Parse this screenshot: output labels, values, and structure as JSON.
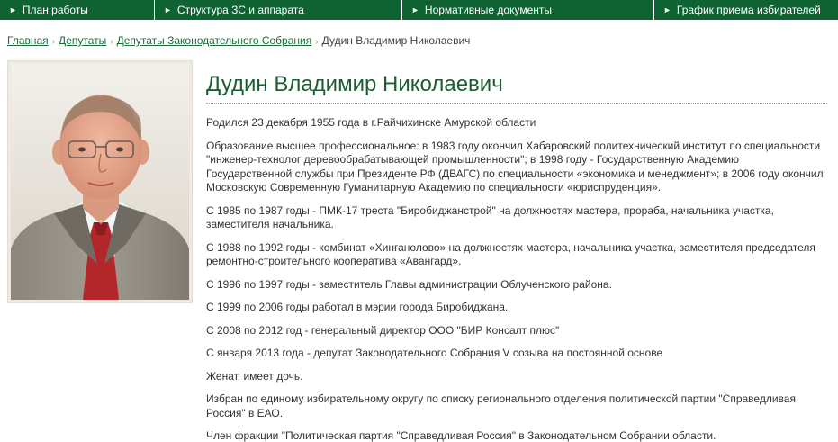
{
  "nav": {
    "items": [
      {
        "label": "План работы"
      },
      {
        "label": "Структура ЗС и аппарата"
      },
      {
        "label": "Нормативные документы"
      },
      {
        "label": "График приема избирателей"
      }
    ],
    "bg_color": "#0f6332",
    "arrow_glyph": "►"
  },
  "breadcrumb": {
    "items": [
      "Главная",
      "Депутаты",
      "Депутаты Законодательного Собрания"
    ],
    "current": "Дудин Владимир Николаевич",
    "separator": "›"
  },
  "profile": {
    "name": "Дудин Владимир Николаевич",
    "paragraphs": [
      "Родился 23 декабря 1955 года в г.Райчихинске Амурской области",
      "Образование высшее профессиональное: в 1983 году окончил Хабаровский политехнический институт по специальности \"инженер-технолог деревообрабатывающей промышленности\"; в 1998 году - Государственную Академию Государственной службы при Президенте РФ (ДВАГС) по специальности «экономика и менеджмент»; в 2006 году окончил Московскую Современную Гуманитарную Академию по специальности «юриспруденция».",
      "С 1985 по 1987 годы - ПМК-17 треста \"Биробиджанстрой\" на должностях мастера, прораба, начальника участка, заместителя начальника.",
      "С 1988 по 1992 годы - комбинат «Хинганолово» на должностях мастера, начальника участка, заместителя председателя ремонтно-строительного кооператива «Авангард».",
      "С 1996 по 1997 годы - заместитель Главы администрации Облученского района.",
      "С 1999 по 2006 годы работал в мэрии города Биробиджана.",
      "С 2008 по 2012 год - генеральный директор ООО \"БИР Консалт плюс\"",
      "С января 2013 года - депутат Законодательного Собрания V созыва на постоянной основе",
      "Женат, имеет дочь.",
      "Избран по единому избирательному округу по списку регионального отделения политической партии \"Справедливая Россия\" в ЕАО.",
      "Член фракции \"Политическая партия \"Справедливая Россия\" в Законодательном Собрании области."
    ]
  },
  "colors": {
    "accent_green": "#0f6332",
    "title_green": "#1c5e34",
    "link_green": "#1a6b3a"
  }
}
